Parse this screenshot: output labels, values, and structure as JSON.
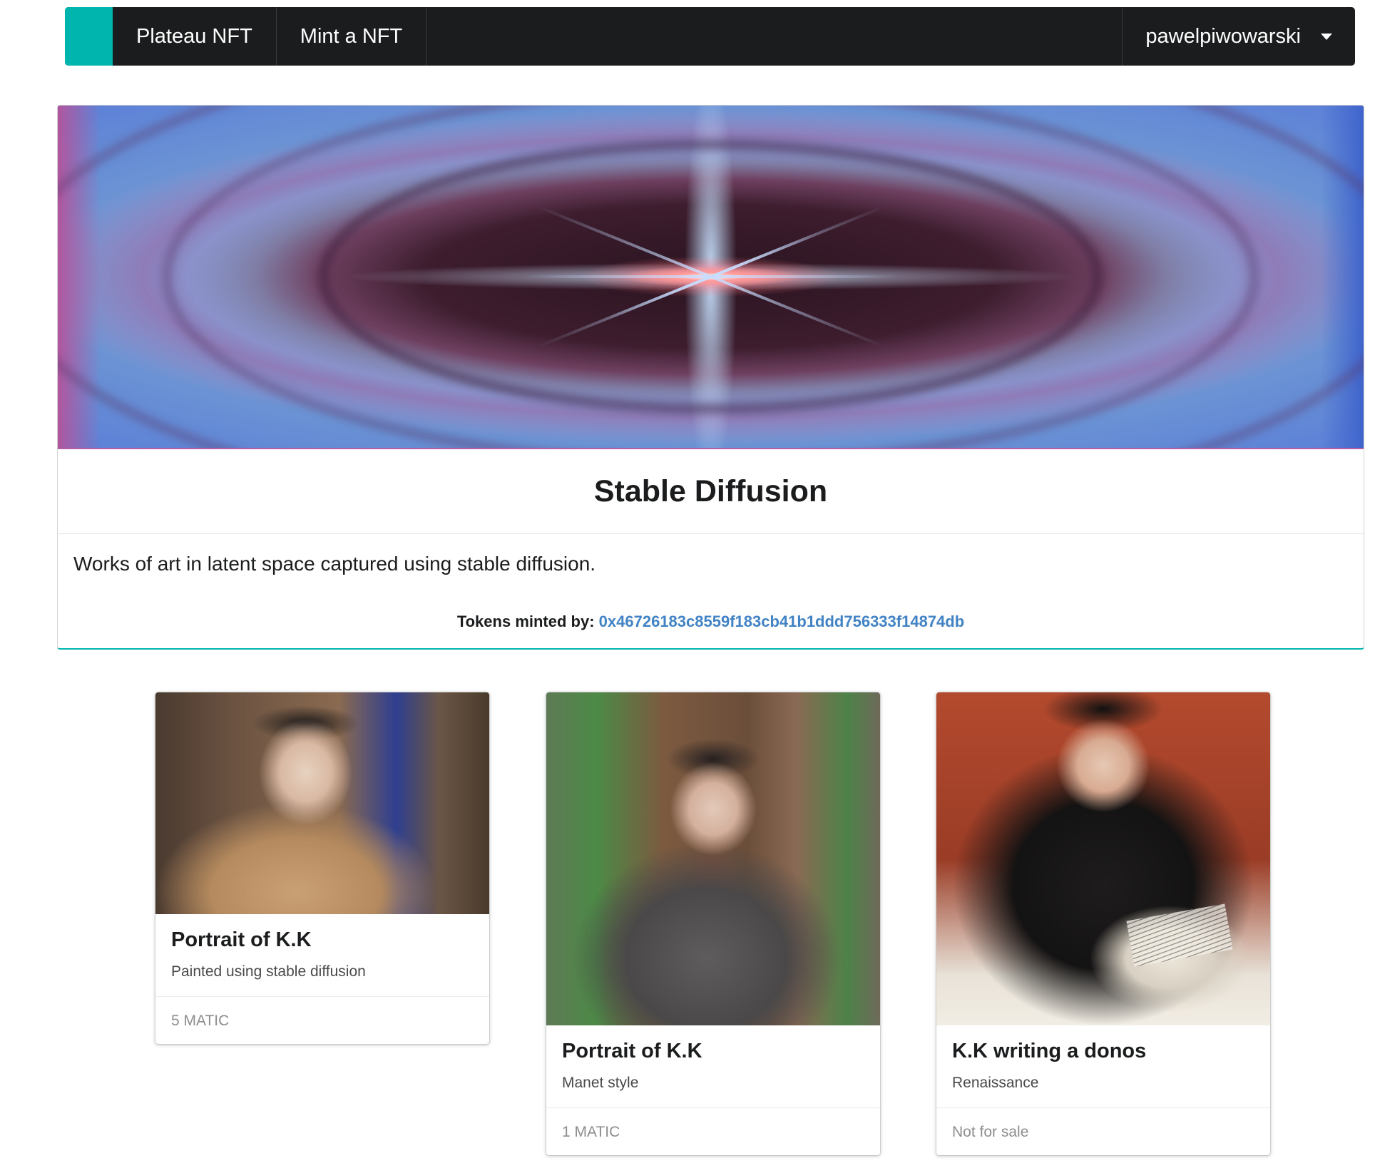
{
  "navbar": {
    "brand": "Plateau NFT",
    "mint": "Mint a NFT",
    "user": "pawelpiwowarski"
  },
  "collection": {
    "title": "Stable Diffusion",
    "description": "Works of art in latent space captured using stable diffusion.",
    "minted_by_label": "Tokens minted by:",
    "minted_by_address": "0x46726183c8559f183cb41b1ddd756333f14874db"
  },
  "nfts": [
    {
      "title": "Portrait of K.K",
      "subtitle": "Painted using stable diffusion",
      "price": "5 MATIC"
    },
    {
      "title": "Portrait of K.K",
      "subtitle": "Manet style",
      "price": "1 MATIC"
    },
    {
      "title": "K.K writing a donos",
      "subtitle": "Renaissance",
      "price": "Not for sale"
    }
  ],
  "colors": {
    "accent": "#00b5ad",
    "navbar": "#1b1c1d",
    "link": "#4183c4"
  }
}
